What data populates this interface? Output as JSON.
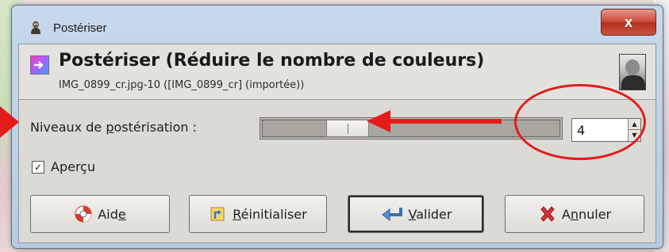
{
  "window": {
    "title": "Postériser",
    "close_glyph": "x"
  },
  "header": {
    "title": "Postériser (Réduire le nombre de couleurs)",
    "subtitle": "IMG_0899_cr.jpg-10 ([IMG_0899_cr] (importée))"
  },
  "levels": {
    "label_before": "Niveaux de ",
    "label_mnemonic": "p",
    "label_after": "ostérisation :",
    "value": "4",
    "slider_min": 2,
    "slider_max": 256,
    "slider_value": 4
  },
  "preview": {
    "label": "Aperçu",
    "checked": true,
    "check_glyph": "✓"
  },
  "buttons": {
    "help": {
      "before": "Aid",
      "mnemonic": "e",
      "after": ""
    },
    "reset": {
      "before": "",
      "mnemonic": "R",
      "after": "éinitialiser"
    },
    "ok": {
      "before": "",
      "mnemonic": "V",
      "after": "alider"
    },
    "cancel": {
      "before": "A",
      "mnemonic": "n",
      "after": "nuler"
    }
  },
  "icons": {
    "title": "gimp-wilber-icon",
    "header": "posterize-icon",
    "thumb": "image-thumbnail",
    "help": "lifebuoy-icon",
    "reset": "reset-icon",
    "ok": "return-arrow-icon",
    "cancel": "cancel-x-icon"
  },
  "colors": {
    "annotation": "#e31b1b",
    "dialog_bg": "#dcdad5"
  }
}
